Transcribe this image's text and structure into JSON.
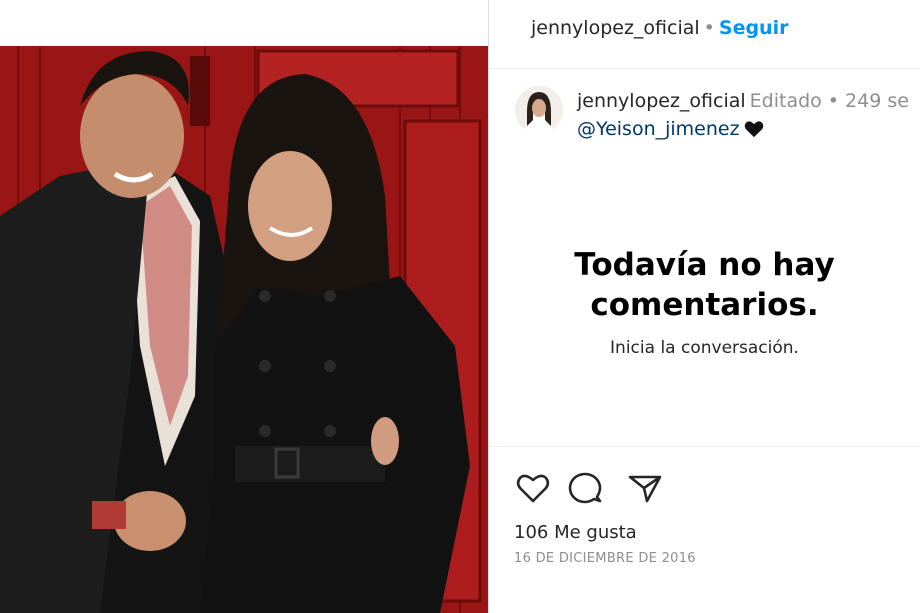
{
  "header": {
    "username": "jennylopez_oficial",
    "separator": "•",
    "follow_label": "Seguir"
  },
  "caption": {
    "username": "jennylopez_oficial",
    "edited_label": "Editado",
    "separator": "•",
    "time": "249 se",
    "mention": "@Yeison_jimenez",
    "heart_emoji": "black-heart-icon"
  },
  "comments": {
    "empty_title_line1": "Todavía no hay",
    "empty_title_line2": "comentarios.",
    "empty_subtitle": "Inicia la conversación."
  },
  "actions": {
    "like_icon": "heart-outline-icon",
    "comment_icon": "comment-icon",
    "share_icon": "share-icon"
  },
  "stats": {
    "likes": "106 Me gusta",
    "date": "16 DE DICIEMBRE DE 2016"
  },
  "colors": {
    "link_blue": "#0095f6",
    "mention_blue": "#00376b",
    "muted": "#8e8e8e",
    "door_red": "#a91c1c"
  }
}
